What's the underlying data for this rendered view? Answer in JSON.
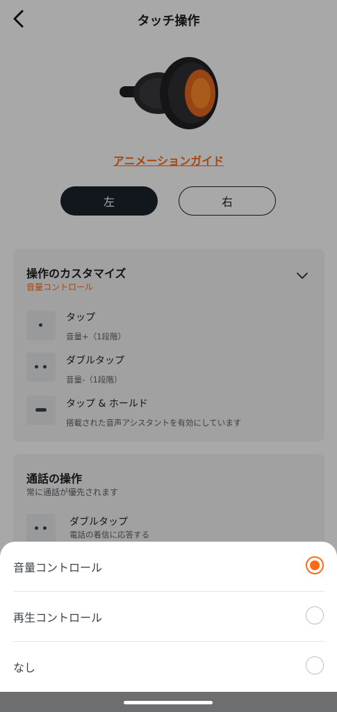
{
  "header": {
    "title": "タッチ操作",
    "back_icon": "chevron-left-icon"
  },
  "guide_link": "アニメーションガイド",
  "side_toggle": {
    "left": "左",
    "right": "右",
    "selected": "左"
  },
  "customize_card": {
    "title": "操作のカスタマイズ",
    "subtitle": "音量コントロール",
    "rows": [
      {
        "icon": "single-dot-icon",
        "label": "タップ",
        "desc": "音量+（1段階）"
      },
      {
        "icon": "double-dot-icon",
        "label": "ダブルタップ",
        "desc": "音量-（1段階）"
      },
      {
        "icon": "hold-bar-icon",
        "label": "タップ & ホールド",
        "desc": "搭載された音声アシスタントを有効にしています"
      }
    ]
  },
  "call_card": {
    "title": "通話の操作",
    "subtitle": "常に通話が優先されます",
    "rows": [
      {
        "icon": "double-dot-icon",
        "label": "ダブルタップ",
        "desc": "電話の着信に応答する"
      }
    ]
  },
  "sheet": {
    "options": [
      {
        "label": "音量コントロール",
        "selected": true
      },
      {
        "label": "再生コントロール",
        "selected": false
      },
      {
        "label": "なし",
        "selected": false
      }
    ]
  },
  "colors": {
    "accent": "#ff6a13",
    "dark": "#1c242c",
    "card_bg": "#f4f5f6"
  }
}
